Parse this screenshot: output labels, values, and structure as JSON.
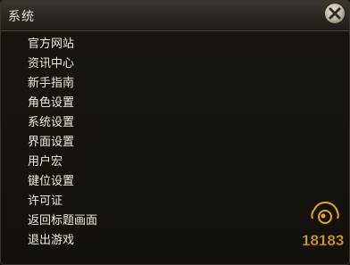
{
  "window": {
    "title": "系统",
    "close_icon": "close-x-icon"
  },
  "menu": {
    "items": [
      {
        "label": "官方网站"
      },
      {
        "label": "资讯中心"
      },
      {
        "label": "新手指南"
      },
      {
        "label": "角色设置"
      },
      {
        "label": "系统设置"
      },
      {
        "label": "界面设置"
      },
      {
        "label": "用户宏"
      },
      {
        "label": "键位设置"
      },
      {
        "label": "许可证"
      },
      {
        "label": "返回标题画面"
      },
      {
        "label": "退出游戏"
      }
    ]
  },
  "watermark": {
    "text": "18183",
    "icon": "site-logo-icon"
  },
  "colors": {
    "background": "#15110d",
    "titlebar": "#2a2622",
    "text": "#f1ede4",
    "watermark": "#e0a826"
  }
}
